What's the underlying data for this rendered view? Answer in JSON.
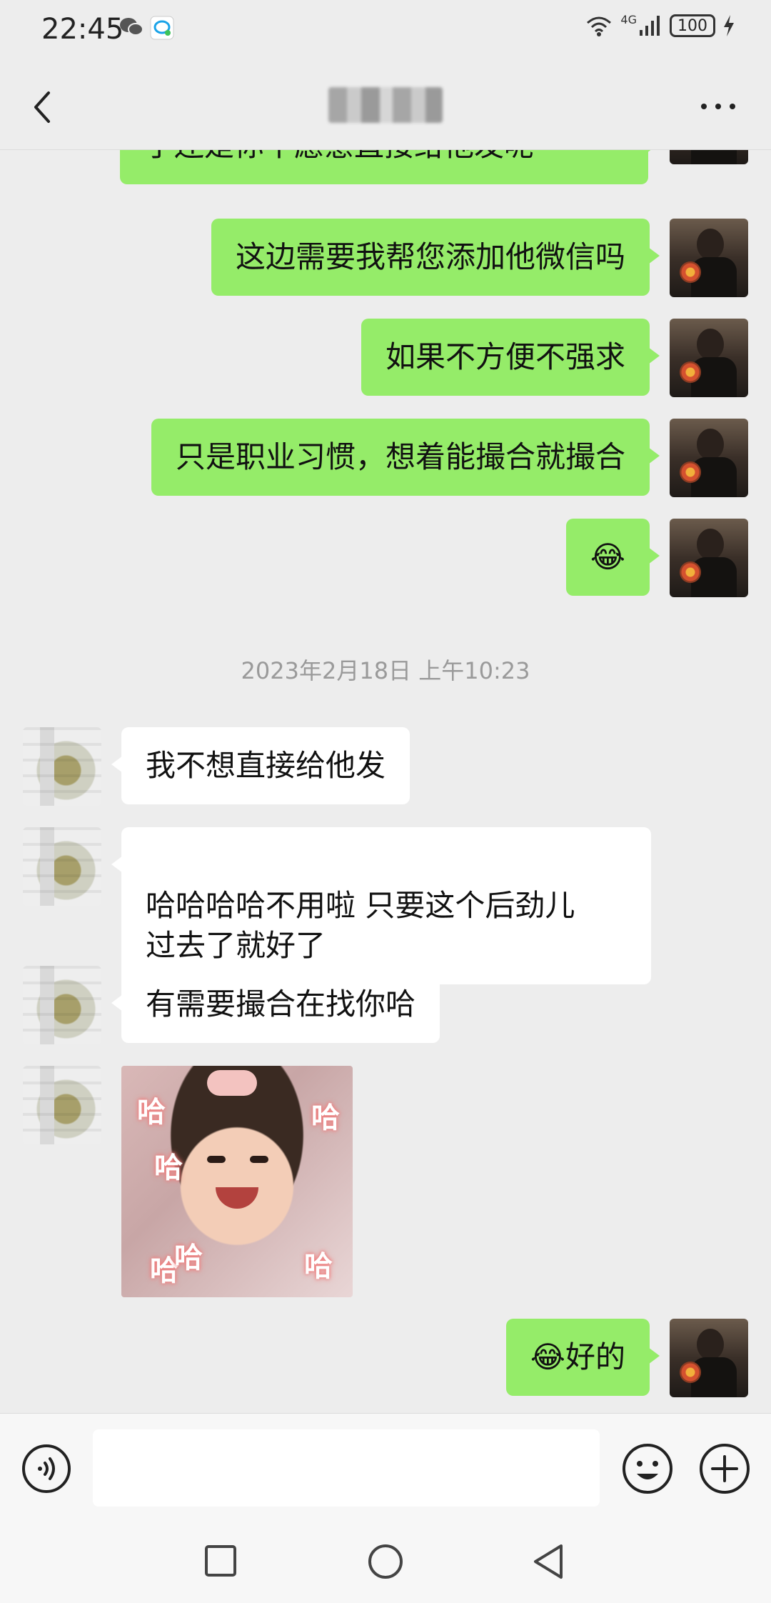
{
  "status_bar": {
    "time": "22:45",
    "network": "4G",
    "battery": "100",
    "icons": [
      "wechat-icon",
      "notification-icon",
      "wifi-icon",
      "signal-icon",
      "battery-icon",
      "charging-icon"
    ]
  },
  "header": {
    "contact_name": "",
    "back_icon": "chevron-left-icon",
    "more_icon": "more-icon"
  },
  "messages": [
    {
      "side": "me",
      "text": "了还是你不愿意直接给他发呢"
    },
    {
      "side": "me",
      "text": "这边需要我帮您添加他微信吗"
    },
    {
      "side": "me",
      "text": "如果不方便不强求"
    },
    {
      "side": "me",
      "text": "只是职业习惯，想着能撮合就撮合"
    },
    {
      "side": "me",
      "text": "😂"
    },
    {
      "side": "other",
      "text": "我不想直接给他发"
    },
    {
      "side": "other",
      "text": "哈哈哈哈不用啦 只要这个后劲儿\n过去了就好了"
    },
    {
      "side": "other",
      "text": "有需要撮合在找你哈"
    },
    {
      "side": "me",
      "text": "😂好的"
    }
  ],
  "timestamp": "2023年2月18日 上午10:23",
  "sticker": {
    "words": [
      "哈",
      "哈",
      "哈",
      "哈",
      "哈",
      "哈"
    ]
  },
  "input_bar": {
    "placeholder": "",
    "icons": [
      "voice-icon",
      "emoji-icon",
      "plus-icon"
    ]
  },
  "nav_bar": {
    "icons": [
      "recent-apps-icon",
      "home-icon",
      "back-icon"
    ]
  },
  "colors": {
    "my_bubble": "#95ec69",
    "other_bubble": "#ffffff",
    "background": "#ededed"
  }
}
